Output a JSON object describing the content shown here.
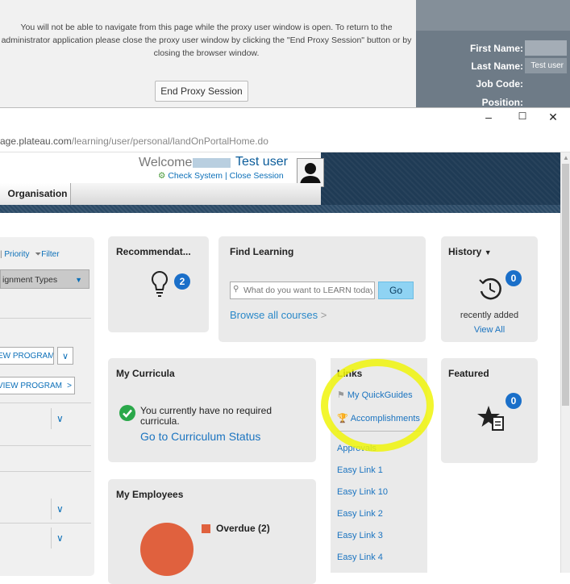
{
  "proxy": {
    "message": "You will not be able to navigate from this page while the proxy user window is open. To return to the administrator application please close the proxy user window by clicking the \"End Proxy Session\" button or by closing the browser window.",
    "end_button": "End Proxy Session"
  },
  "profile": {
    "first_name_label": "First Name:",
    "last_name_label": "Last Name:",
    "last_name_value": "Test user",
    "job_code_label": "Job Code:",
    "position_label": "Position:"
  },
  "window": {
    "minimize": "–",
    "maximize": "☐",
    "close": "✕"
  },
  "url": {
    "host": "age.plateau.com",
    "path": "/learning/user/personal/landOnPortalHome.do"
  },
  "header": {
    "welcome": "Welcome",
    "user": "Test user",
    "check_system": "Check System",
    "separator": "|",
    "close_session": "Close Session",
    "tab_organisation": "Organisation"
  },
  "left_panel": {
    "priority": "Priority",
    "filter": "Filter",
    "assignment_types": "ignment Types",
    "view_program_1": "EW PROGRAM",
    "view_program_2": "VIEW PROGRAM"
  },
  "recommendations": {
    "title": "Recommendat...",
    "count": "2"
  },
  "find_learning": {
    "title": "Find Learning",
    "placeholder": "What do you want to LEARN today?",
    "go": "Go",
    "browse": "Browse all courses"
  },
  "history": {
    "title": "History",
    "count": "0",
    "recently_added": "recently added",
    "view_all": "View All"
  },
  "curricula": {
    "title": "My Curricula",
    "message": "You currently have no required curricula.",
    "link": "Go to Curriculum Status"
  },
  "links": {
    "title": "Links",
    "items": [
      "My QuickGuides",
      "Accomplishments",
      "Approvals",
      "Easy Link 1",
      "Easy Link 10",
      "Easy Link 2",
      "Easy Link 3",
      "Easy Link 4"
    ]
  },
  "featured": {
    "title": "Featured",
    "count": "0"
  },
  "employees": {
    "title": "My Employees",
    "overdue": "Overdue (2)"
  },
  "colors": {
    "accent": "#1a6fc9",
    "overdue": "#e0613e",
    "highlight": "#f0f50a",
    "header": "#1f3b55"
  }
}
